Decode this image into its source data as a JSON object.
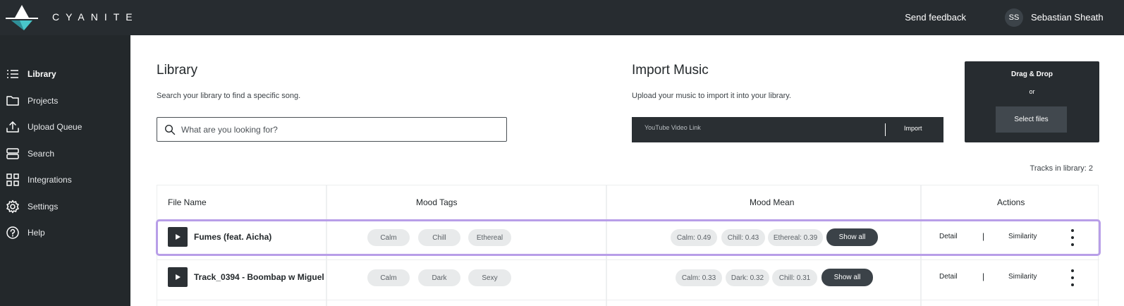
{
  "topbar": {
    "brand": "CYANITE",
    "send_feedback": "Send feedback",
    "avatar_initials": "SS",
    "user_name": "Sebastian Sheath"
  },
  "sidebar": {
    "items": [
      {
        "label": "Library",
        "icon": "list-icon",
        "active": true
      },
      {
        "label": "Projects",
        "icon": "folder-icon",
        "active": false
      },
      {
        "label": "Upload Queue",
        "icon": "upload-icon",
        "active": false
      },
      {
        "label": "Search",
        "icon": "search-panels-icon",
        "active": false
      },
      {
        "label": "Integrations",
        "icon": "grid-icon",
        "active": false
      },
      {
        "label": "Settings",
        "icon": "gear-icon",
        "active": false
      },
      {
        "label": "Help",
        "icon": "help-icon",
        "active": false
      }
    ]
  },
  "library": {
    "title": "Library",
    "subtitle": "Search your library to find a specific song.",
    "search_placeholder": "What are you looking for?"
  },
  "import_music": {
    "title": "Import Music",
    "subtitle": "Upload your music to import it into your library.",
    "link_placeholder": "YouTube Video Link",
    "import_label": "Import"
  },
  "dropzone": {
    "title": "Drag & Drop",
    "or": "or",
    "select_files": "Select files"
  },
  "tracks_count": "Tracks in library: 2",
  "table": {
    "headers": {
      "file_name": "File Name",
      "mood_tags": "Mood Tags",
      "mood_mean": "Mood Mean",
      "actions": "Actions"
    },
    "rows": [
      {
        "file_name": "Fumes (feat. Aicha)",
        "mood_tags": [
          "Calm",
          "Chill",
          "Ethereal"
        ],
        "mood_mean": [
          "Calm: 0.49",
          "Chill: 0.43",
          "Ethereal: 0.39"
        ],
        "show_all": "Show all",
        "detail": "Detail",
        "separator": "|",
        "similarity": "Similarity",
        "selected": true
      },
      {
        "file_name": "Track_0394 - Boombap w Miguel",
        "mood_tags": [
          "Calm",
          "Dark",
          "Sexy"
        ],
        "mood_mean": [
          "Calm: 0.33",
          "Dark: 0.32",
          "Chill: 0.31"
        ],
        "show_all": "Show all",
        "detail": "Detail",
        "separator": "|",
        "similarity": "Similarity",
        "selected": false
      }
    ]
  },
  "colors": {
    "topbar_bg": "#272c30",
    "sidebar_bg": "#23282b",
    "selection_outline": "#b89ee8",
    "chip_bg": "#e8eaeb",
    "show_all_bg": "#3b4248"
  }
}
